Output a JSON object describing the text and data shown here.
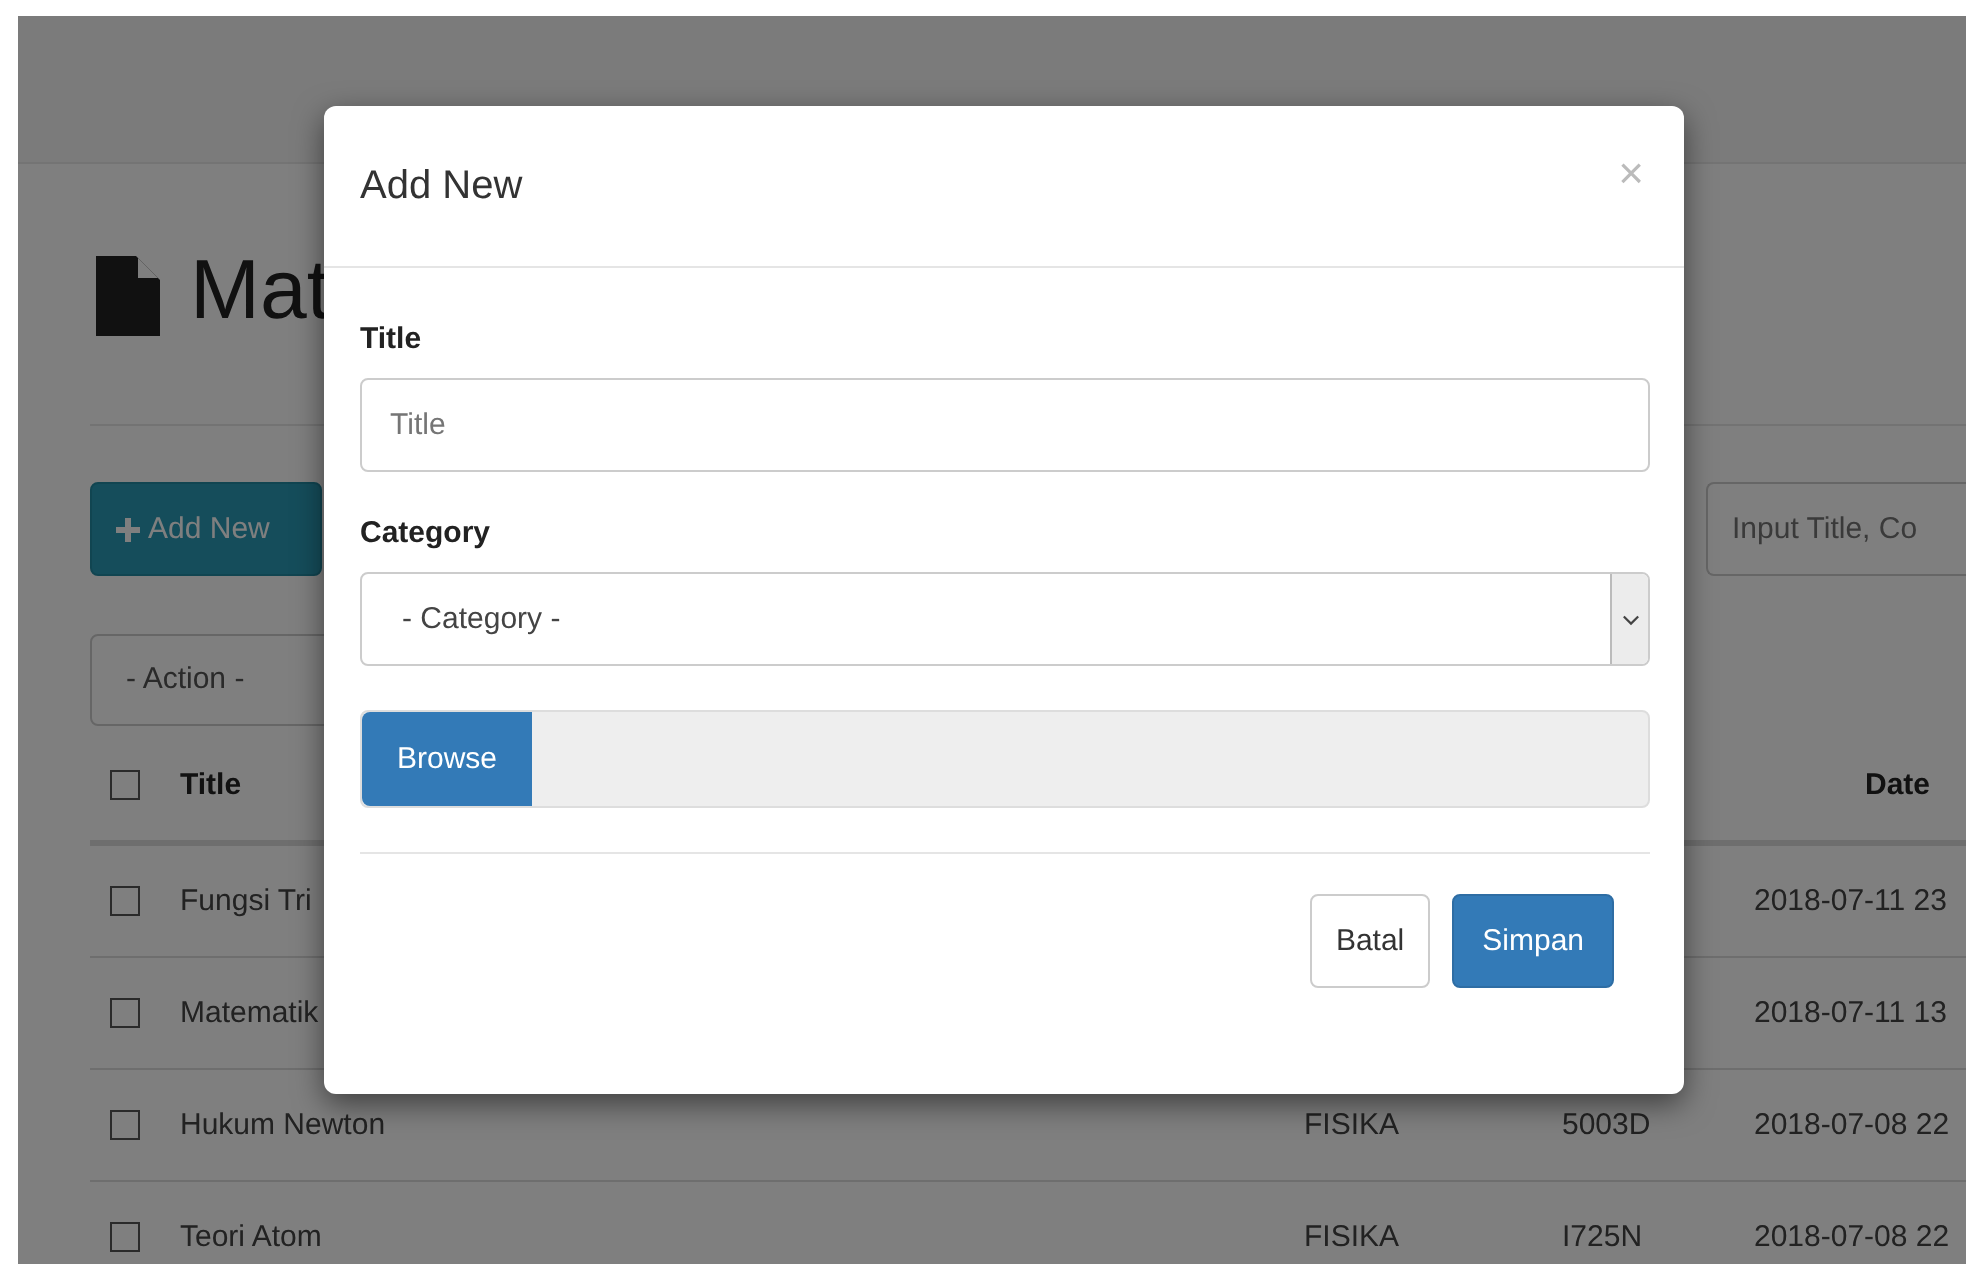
{
  "page": {
    "heading": "Mat",
    "add_button": "Add New",
    "action_select": "- Action -",
    "search": {
      "placeholder": "Input Title, Co"
    },
    "table": {
      "header_checked": false,
      "columns": [
        "Title",
        "Date"
      ],
      "rows": [
        {
          "checked": false,
          "title": "Fungsi Tri",
          "date": "2018-07-11 23"
        },
        {
          "checked": false,
          "title": "Matematik",
          "date": "2018-07-11 13"
        },
        {
          "checked": false,
          "title": "Hukum Newton",
          "category": "FISIKA",
          "code": "5003D",
          "date": "2018-07-08 22"
        },
        {
          "checked": false,
          "title": "Teori Atom",
          "category": "FISIKA",
          "code": "I725N",
          "date": "2018-07-08 22"
        }
      ]
    }
  },
  "modal": {
    "title": "Add New",
    "close": "×",
    "fields": [
      {
        "kind": "text",
        "label": "Title",
        "placeholder": "Title"
      },
      {
        "kind": "select",
        "label": "Category",
        "value": "- Category -"
      },
      {
        "kind": "file",
        "button": "Browse"
      }
    ],
    "buttons": [
      {
        "label": "Batal",
        "primary": false
      },
      {
        "label": "Simpan",
        "primary": true
      }
    ]
  }
}
